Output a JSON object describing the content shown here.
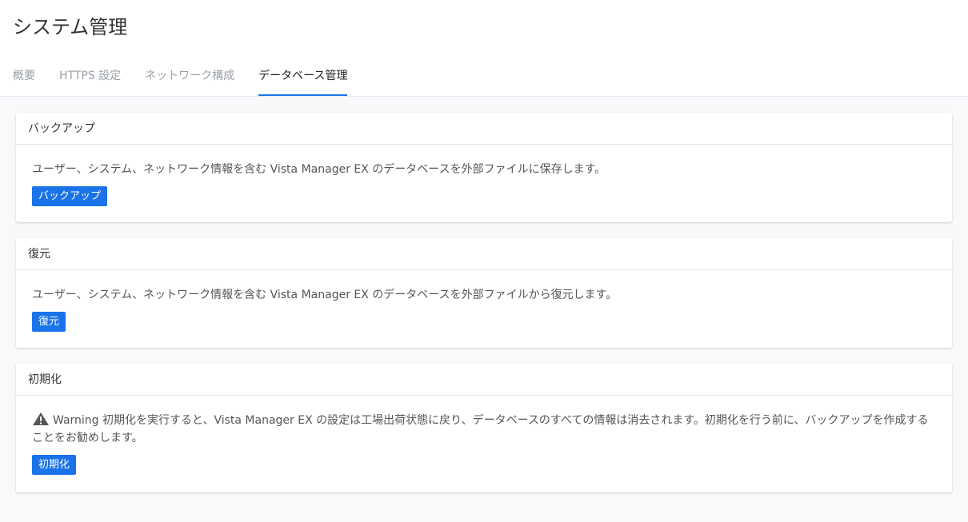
{
  "page": {
    "title": "システム管理"
  },
  "tabs": [
    {
      "label": "概要",
      "active": false
    },
    {
      "label": "HTTPS 設定",
      "active": false
    },
    {
      "label": "ネットワーク構成",
      "active": false
    },
    {
      "label": "データベース管理",
      "active": true
    }
  ],
  "sections": {
    "backup": {
      "title": "バックアップ",
      "description": "ユーザー、システム、ネットワーク情報を含む Vista Manager EX のデータベースを外部ファイルに保存します。",
      "button_label": "バックアップ"
    },
    "restore": {
      "title": "復元",
      "description": "ユーザー、システム、ネットワーク情報を含む Vista Manager EX のデータベースを外部ファイルから復元します。",
      "button_label": "復元"
    },
    "init": {
      "title": "初期化",
      "warning_label": "Warning",
      "description": "初期化を実行すると、Vista Manager EX の設定は工場出荷状態に戻り、データベースのすべての情報は消去されます。初期化を行う前に、バックアップを作成することをお勧めします。",
      "button_label": "初期化",
      "icon": "warning-triangle-icon"
    }
  },
  "colors": {
    "accent": "#1a73e8",
    "background": "#f8f9fb",
    "card": "#ffffff"
  }
}
